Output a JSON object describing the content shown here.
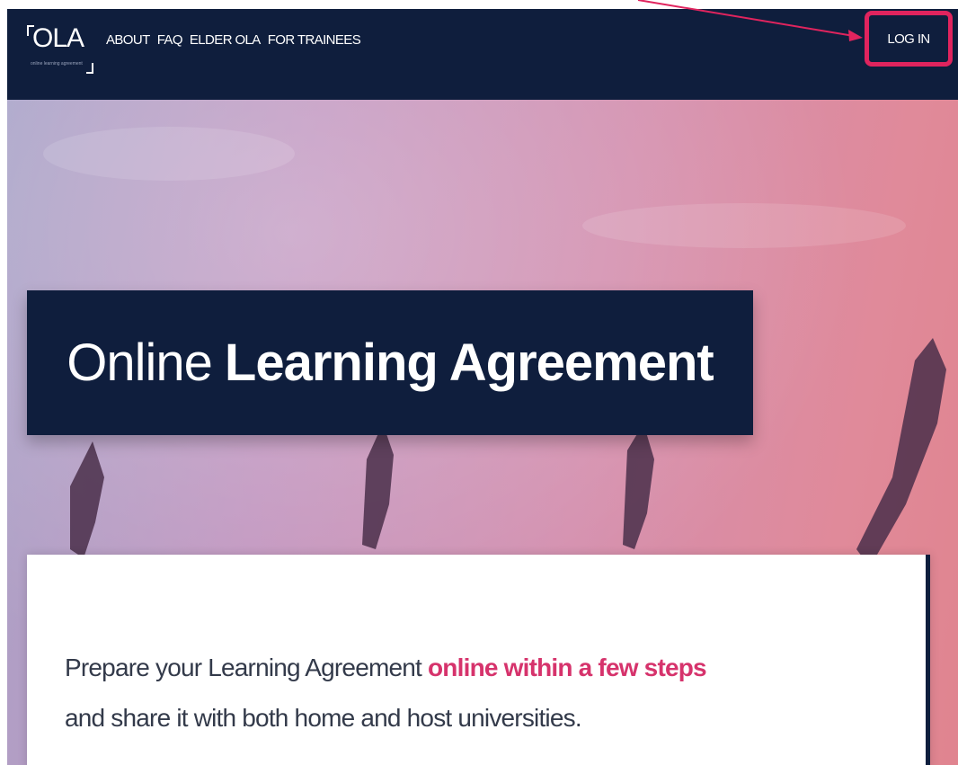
{
  "nav": {
    "logo_text": "OLA",
    "logo_subtitle": "online learning agreement",
    "links": [
      "ABOUT",
      "FAQ",
      "ELDER OLA",
      "FOR TRAINEES"
    ],
    "login_label": "LOG IN"
  },
  "hero": {
    "title_light": "Online",
    "title_bold": "Learning Agreement"
  },
  "card": {
    "line1_prefix": "Prepare your Learning Agreement ",
    "line1_highlight": "online within a few steps",
    "line2": "and share it with both home and host universities."
  },
  "colors": {
    "nav_bg": "#0f1e3d",
    "accent": "#d6336c",
    "login_highlight": "#e0245e"
  }
}
